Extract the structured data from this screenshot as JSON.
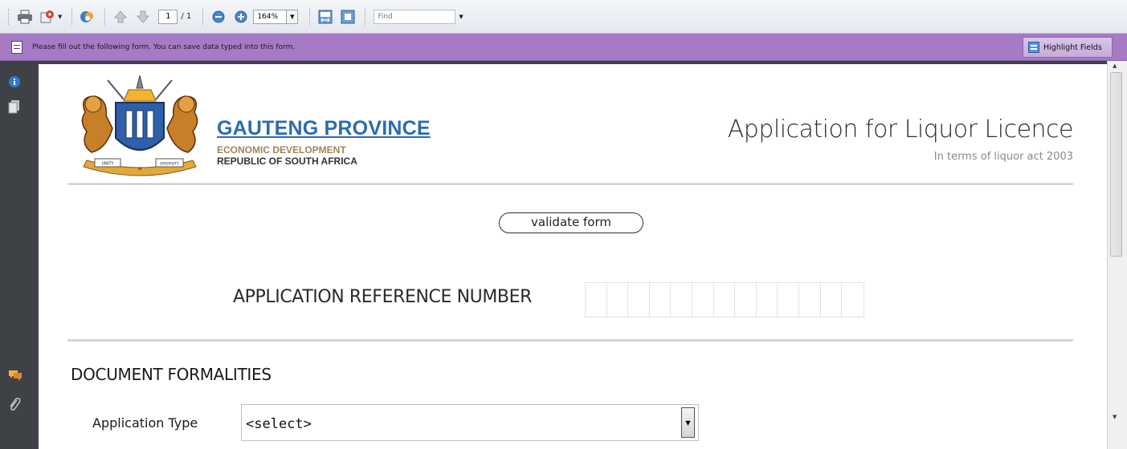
{
  "toolbar": {
    "page_current": "1",
    "page_total": "/ 1",
    "zoom": "164%",
    "find_placeholder": "Find",
    "icons": [
      "print-icon",
      "share-icon",
      "collaborate-icon",
      "previous-page-icon",
      "next-page-icon",
      "zoom-out-icon",
      "zoom-in-icon",
      "fit-width-icon",
      "full-screen-icon"
    ]
  },
  "formbar": {
    "message": "Please fill out the following form. You can save data typed into this form.",
    "highlight_label": "Highlight Fields"
  },
  "document": {
    "org": {
      "name": "GAUTENG PROVINCE",
      "department": "ECONOMIC DEVELOPMENT",
      "country": "REPUBLIC OF SOUTH AFRICA",
      "crest_motto": [
        "UNITY",
        "IN",
        "DIVERSITY"
      ]
    },
    "title": "Application for Liquor Licence",
    "subtitle": "In terms of liquor act 2003",
    "validate_label": "validate form",
    "reference_label": "APPLICATION REFERENCE NUMBER",
    "reference_boxes": 13,
    "section_title": "DOCUMENT FORMALITIES",
    "application_type_label": "Application Type",
    "application_type_value": "<select>"
  },
  "colors": {
    "formbar": "#a77ac5",
    "org_name": "#2b6cb0",
    "org_sub": "#a08458",
    "nav": "#3e4247"
  }
}
